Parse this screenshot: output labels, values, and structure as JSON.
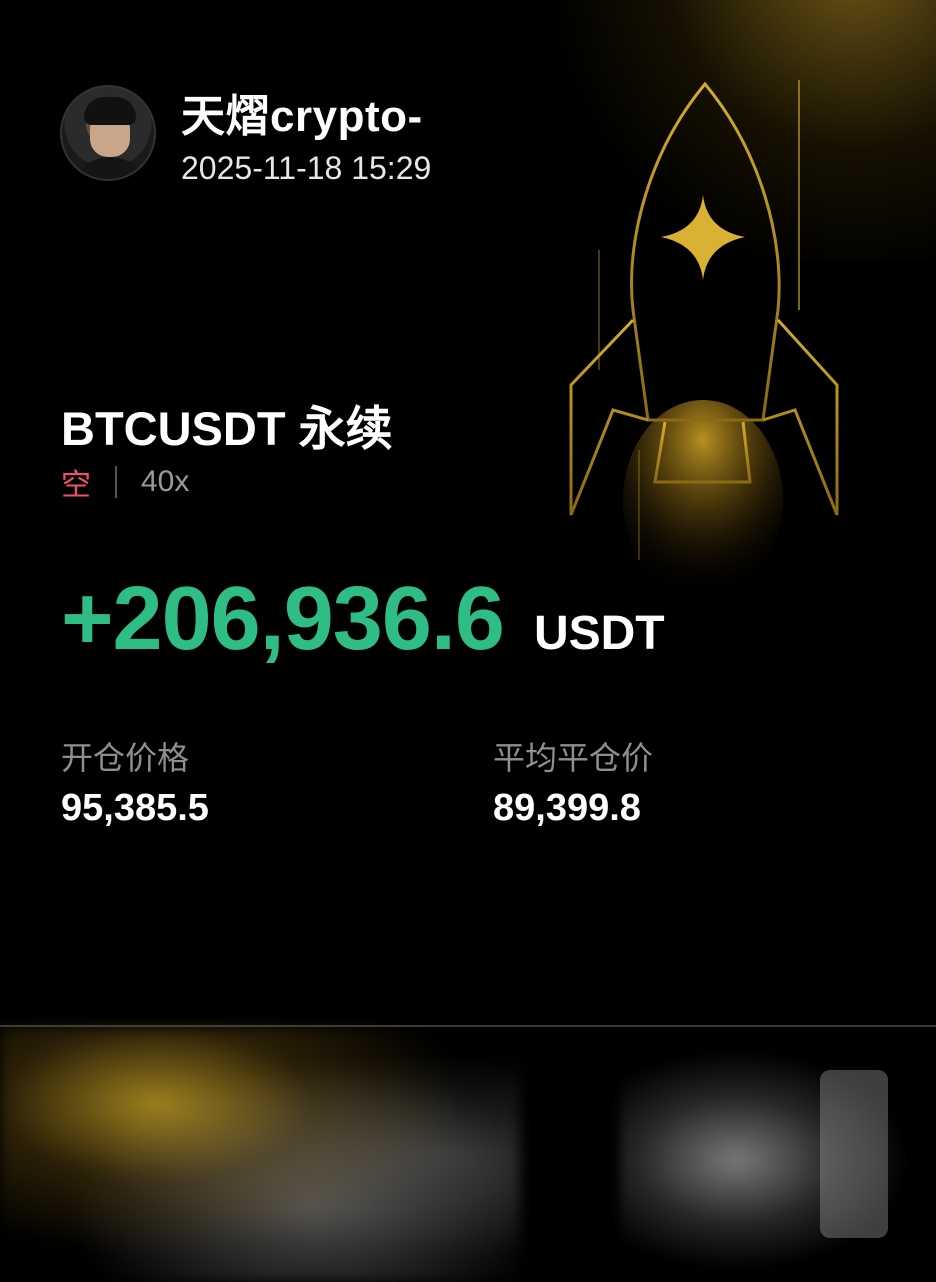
{
  "user": {
    "name": "天熠crypto-",
    "timestamp": "2025-11-18 15:29"
  },
  "position": {
    "pair": "BTCUSDT 永续",
    "side": "空",
    "leverage": "40x",
    "pnl_value": "+206,936.6",
    "pnl_unit": "USDT"
  },
  "stats": {
    "entry_label": "开仓价格",
    "entry_value": "95,385.5",
    "close_label": "平均平仓价",
    "close_value": "89,399.8"
  },
  "colors": {
    "profit": "#2ebd85",
    "short": "#f0506e",
    "gold": "#c9a227"
  },
  "icons": {
    "rocket": "rocket-icon",
    "avatar": "avatar"
  }
}
